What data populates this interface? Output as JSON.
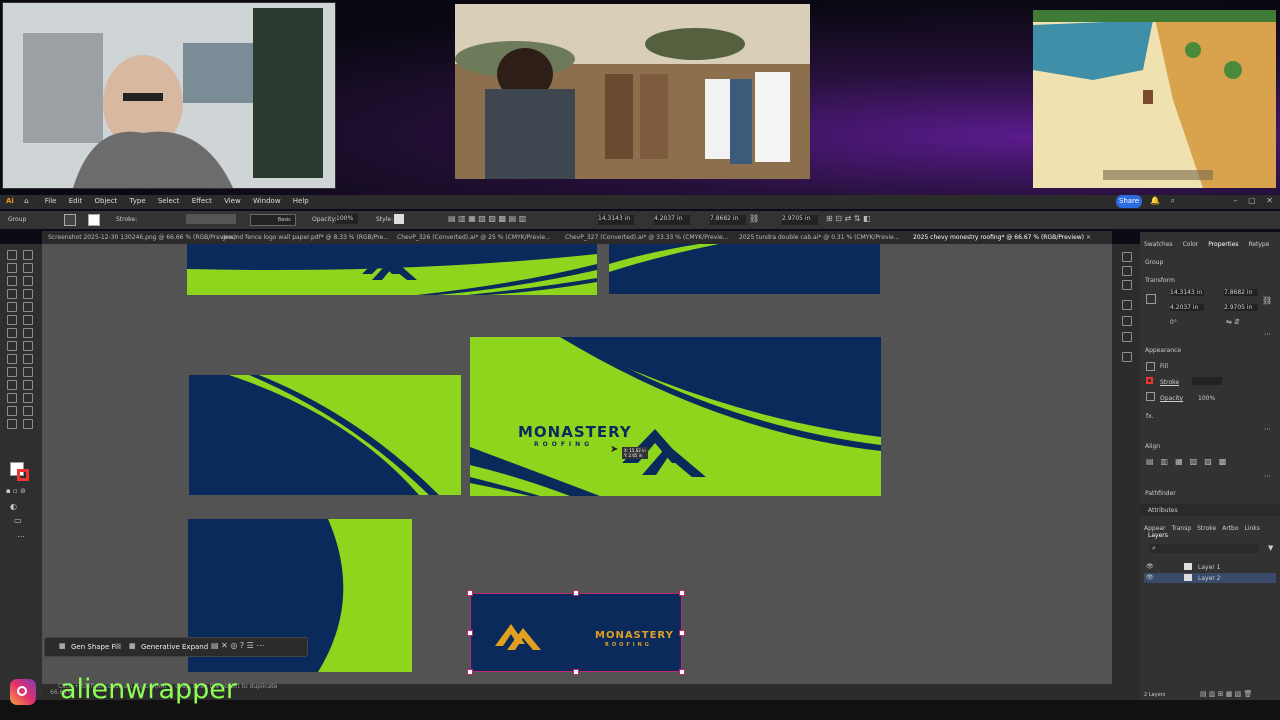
{
  "app": {
    "menu": [
      "File",
      "Edit",
      "Object",
      "Type",
      "Select",
      "Effect",
      "View",
      "Window",
      "Help"
    ],
    "share_label": "Share"
  },
  "control_bar": {
    "group_label": "Group",
    "stroke_label": "Stroke:",
    "style_label": "Style:",
    "opacity_label": "Opacity:",
    "opacity_value": "100%",
    "basic_label": "Basic",
    "x_value": "14.3143 in",
    "y_value": "4.2037 in",
    "w_value": "7.8682 in",
    "h_value": "2.9705 in"
  },
  "tabs": [
    "Screenshot 2025-12-30 130246.png @ 66.66 % (RGB/Preview)",
    "ground fence logo wall paper.pdf* @ 8.33 % (RGB/Pre...",
    "ChevP_326 (Converted).ai* @ 25 % (CMYK/Previe...",
    "ChevP_327 (Converted).ai* @ 33.33 % (CMYK/Previe...",
    "2025 tundra double cab.ai* @ 0.31 % (CMYK/Previe...",
    "2025 chevy monestry roofing* @ 66.67 % (RGB/Preview)"
  ],
  "design": {
    "brand_title": "MONASTERY",
    "brand_subtitle": "ROOFING",
    "cursor_readout_x": "X: 15.62 in",
    "cursor_readout_y": "Y: 2.65 in"
  },
  "context_bar": {
    "gen_shape_fill": "Gen Shape Fill",
    "generative_expand": "Generative Expand"
  },
  "status": {
    "zoom": "66.67%",
    "hint": "Click + Shift to constrain. Option/Alt + drag: Drag the object to duplicate"
  },
  "panel": {
    "tabs": [
      "Swatches",
      "Color",
      "Properties",
      "Retype"
    ],
    "group_label": "Group",
    "transform_label": "Transform",
    "x": "14.3143 in",
    "y": "4.2037 in",
    "w": "7.8682 in",
    "h": "2.9705 in",
    "angle": "0°",
    "appearance_label": "Appearance",
    "fill_label": "Fill",
    "stroke_label": "Stroke",
    "opacity_label": "Opacity",
    "opacity_value": "100%",
    "fx_label": "fx.",
    "align_label": "Align",
    "pathfinder_label": "Pathfinder",
    "attributes_label": "Attributes",
    "lower_tabs": [
      "Appear",
      "Transp",
      "Stroke",
      "Artbo",
      "Links",
      "Layers"
    ],
    "layers": [
      "Layer 1",
      "Layer 2"
    ],
    "layers_count": "2 Layers"
  },
  "overlay": {
    "handle": "alienwrapper"
  },
  "colors": {
    "lime": "#8ed61e",
    "navy": "#0b2a5c",
    "gold": "#e0a020",
    "selection": "#c0286e"
  }
}
